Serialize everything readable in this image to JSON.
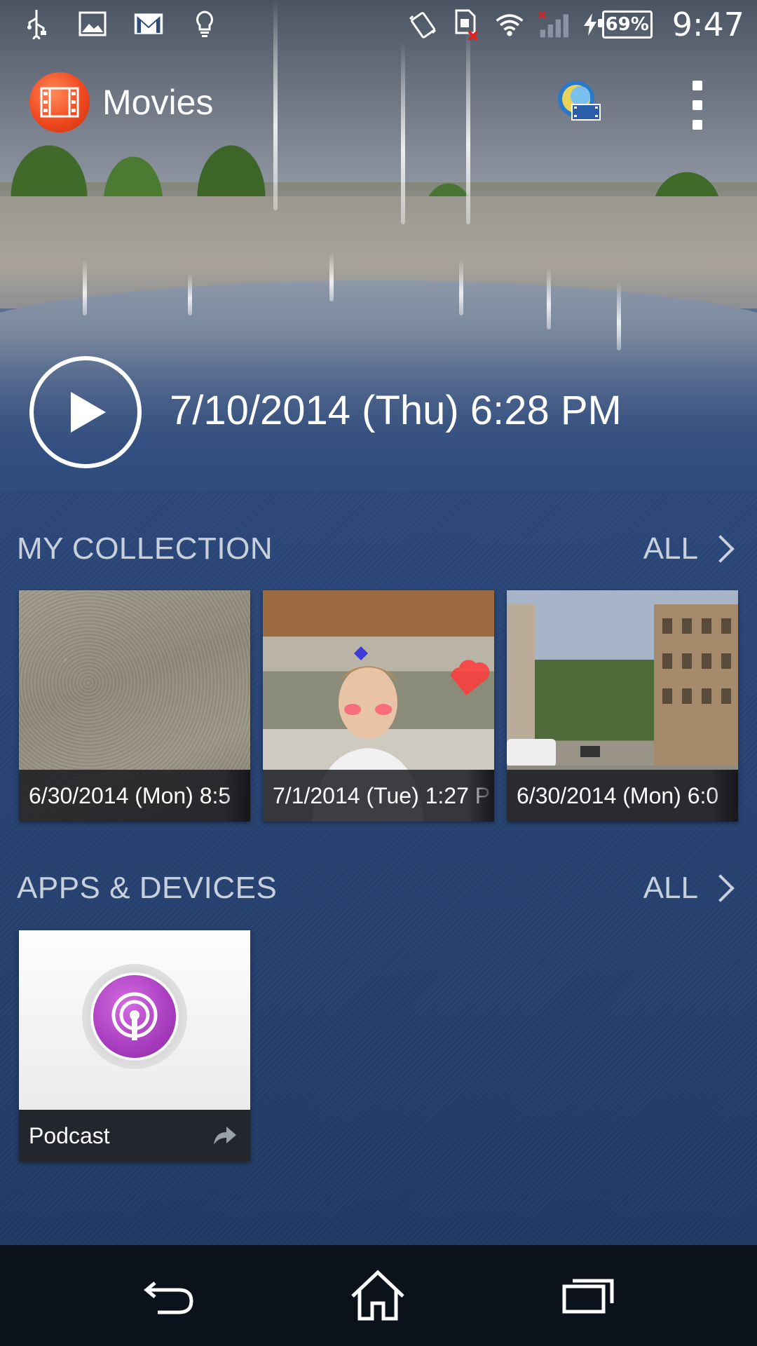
{
  "status_bar": {
    "left_icons": [
      "usb-icon",
      "image-icon",
      "gmail-icon",
      "lightbulb-icon"
    ],
    "right_icons": [
      "vibrate-icon",
      "no-sim-icon",
      "wifi-icon",
      "signal-icon",
      "charging-icon"
    ],
    "battery_percent": "69%",
    "time": "9:47"
  },
  "action_bar": {
    "title": "Movies",
    "app_icon": "film-icon",
    "action_icon": "movie-info-icon",
    "overflow_icon": "overflow-menu-icon"
  },
  "featured": {
    "play_icon": "play-icon",
    "date": "7/10/2014 (Thu) 6:28 PM"
  },
  "my_collection": {
    "title": "MY COLLECTION",
    "all_label": "ALL",
    "items": [
      {
        "caption": "6/30/2014 (Mon) 8:5"
      },
      {
        "caption": "7/1/2014 (Tue) 1:27 P"
      },
      {
        "caption": "6/30/2014 (Mon) 6:0"
      }
    ]
  },
  "apps_devices": {
    "title": "APPS & DEVICES",
    "all_label": "ALL",
    "items": [
      {
        "caption": "Podcast",
        "icon": "podcast-icon"
      }
    ]
  },
  "nav_bar": {
    "buttons": [
      "back-icon",
      "home-icon",
      "recents-icon"
    ]
  },
  "colors": {
    "background": "#2a4677",
    "section_title": "#c8d0dc",
    "app_icon": "#f0491f",
    "podcast": "#a83dbf",
    "nav_bar": "#0c121c"
  }
}
